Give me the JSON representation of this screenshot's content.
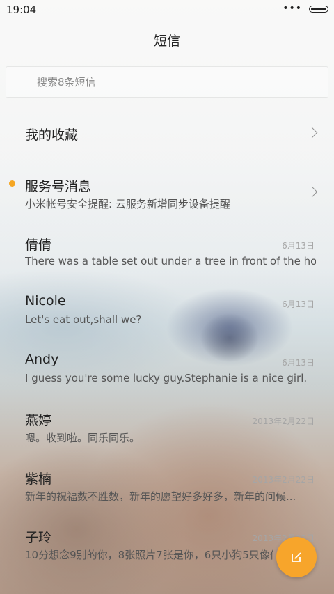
{
  "status_bar": {
    "time": "19:04",
    "dots": "•••"
  },
  "header": {
    "title": "短信"
  },
  "search": {
    "placeholder": "搜索8条短信"
  },
  "favorites": {
    "label": "我的收藏"
  },
  "service": {
    "title": "服务号消息",
    "preview": "小米帐号安全提醒: 云服务新增同步设备提醒",
    "unread": true
  },
  "conversations": [
    {
      "name": "倩倩",
      "preview": "There was a table set out under a tree in front of the ho...",
      "date": "6月13日"
    },
    {
      "name": "Nicole",
      "preview": "Let's eat out,shall we?",
      "date": "6月13日"
    },
    {
      "name": "Andy",
      "preview": "I guess you're some lucky guy.Stephanie is a nice girl.",
      "date": "6月13日"
    },
    {
      "name": "燕婷",
      "preview": "嗯。收到啦。同乐同乐。",
      "date": "2013年2月22日"
    },
    {
      "name": "紫楠",
      "preview": "新年的祝福数不胜数，新年的愿望好多好多，新年的问候...",
      "date": "2013年2月22日"
    },
    {
      "name": "子玲",
      "preview": "10分想念9别的你，8张照片7张是你，6只小狗5只像你",
      "date": "2013年2月22日"
    }
  ],
  "colors": {
    "accent": "#f7a52b",
    "unread_dot": "#f5a623"
  },
  "icons": {
    "compose": "compose-icon",
    "chevron": "chevron-right-icon"
  }
}
